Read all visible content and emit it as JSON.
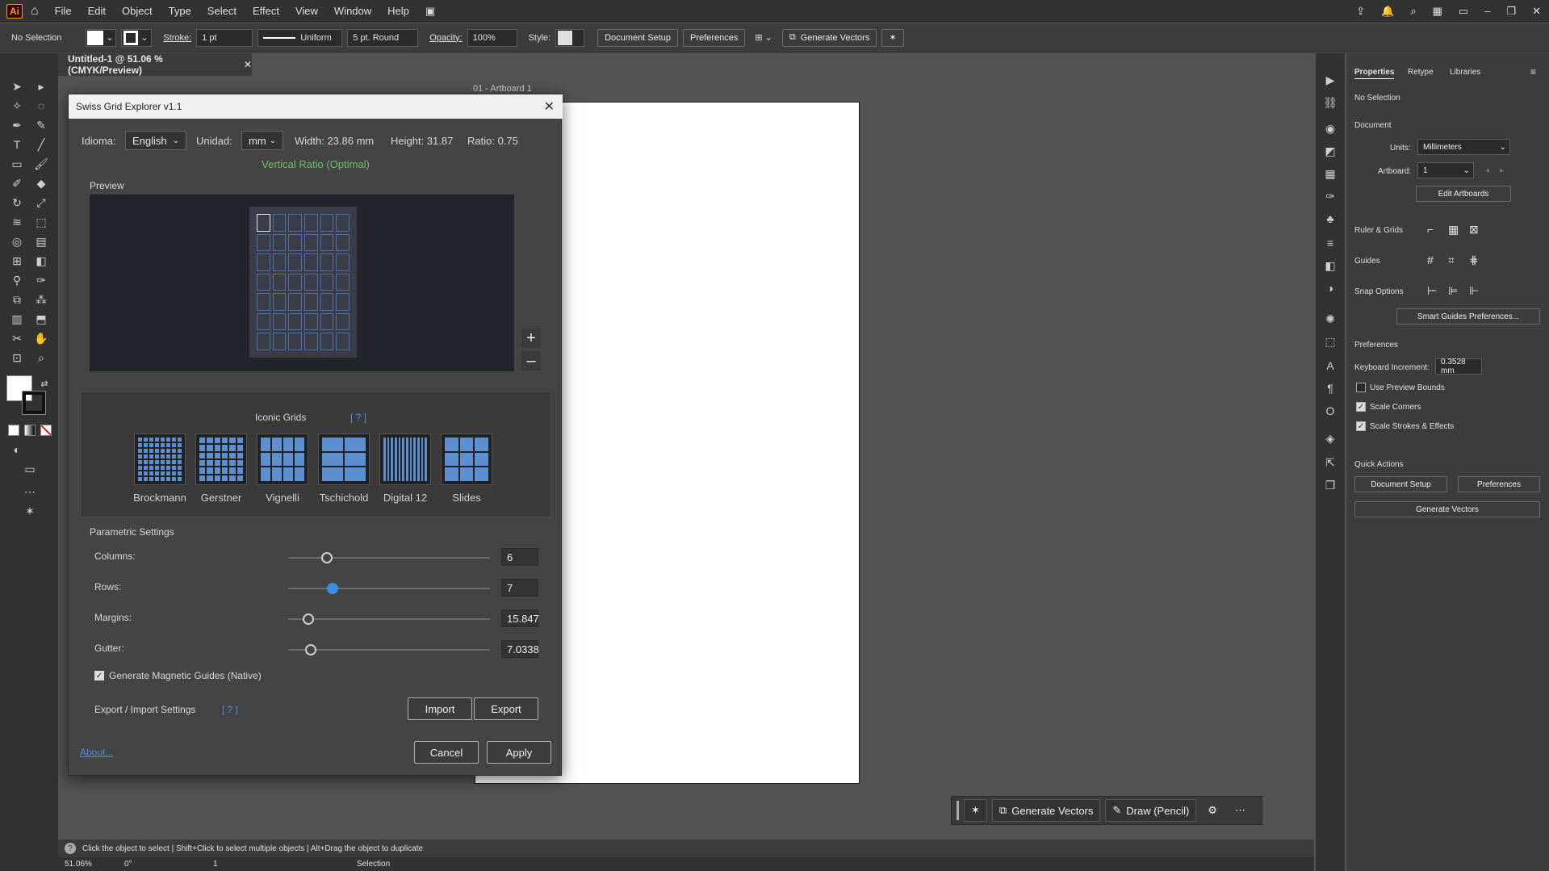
{
  "menubar": {
    "logo": "Ai",
    "items": [
      "File",
      "Edit",
      "Object",
      "Type",
      "Select",
      "Effect",
      "View",
      "Window",
      "Help"
    ]
  },
  "control": {
    "selection": "No Selection",
    "stroke_label": "Stroke:",
    "stroke_value": "1 pt",
    "profile": "Uniform",
    "brush": "5 pt. Round",
    "opacity_label": "Opacity:",
    "opacity_value": "100%",
    "style_label": "Style:",
    "document_setup": "Document Setup",
    "preferences": "Preferences",
    "generate_vectors": "Generate Vectors"
  },
  "document": {
    "tab": "Untitled-1 @ 51.06 % (CMYK/Preview)",
    "artboard_label": "01 - Artboard 1"
  },
  "dialog": {
    "title": "Swiss Grid Explorer v1.1",
    "idioma_label": "Idioma:",
    "idioma_value": "English",
    "unidad_label": "Unidad:",
    "unidad_value": "mm",
    "width": "Width: 23.86 mm",
    "height": "Height: 31.87",
    "ratio": "Ratio: 0.75",
    "ratio_status": "Vertical Ratio (Optimal)",
    "preview_label": "Preview",
    "iconic_label": "Iconic Grids",
    "help_link": "[ ? ]",
    "grids": [
      "Brockmann",
      "Gerstner",
      "Vignelli",
      "Tschichold",
      "Digital 12",
      "Slides"
    ],
    "parametric_label": "Parametric Settings",
    "params": [
      {
        "label": "Columns:",
        "value": "6",
        "pos": 0.19,
        "active": false
      },
      {
        "label": "Rows:",
        "value": "7",
        "pos": 0.22,
        "active": true
      },
      {
        "label": "Margins:",
        "value": "15.847",
        "pos": 0.1,
        "active": false
      },
      {
        "label": "Gutter:",
        "value": "7.0338",
        "pos": 0.11,
        "active": false
      }
    ],
    "magnetic_label": "Generate Magnetic Guides (Native)",
    "export_label": "Export / Import Settings",
    "import": "Import",
    "export": "Export",
    "about": "About...",
    "cancel": "Cancel",
    "apply": "Apply",
    "preview_grid": {
      "columns": 6,
      "rows": 7
    }
  },
  "properties": {
    "tabs": [
      "Properties",
      "Retype",
      "Libraries"
    ],
    "no_selection": "No Selection",
    "document": "Document",
    "units_label": "Units:",
    "units_value": "Millimeters",
    "artboard_label": "Artboard:",
    "artboard_value": "1",
    "edit_artboards": "Edit Artboards",
    "ruler_grids": "Ruler & Grids",
    "guides": "Guides",
    "snap_options": "Snap Options",
    "smart_guides": "Smart Guides Preferences...",
    "preferences": "Preferences",
    "keyboard_increment_label": "Keyboard Increment:",
    "keyboard_increment_value": "0.3528 mm",
    "use_preview_bounds": "Use Preview Bounds",
    "scale_corners": "Scale Corners",
    "scale_strokes": "Scale Strokes & Effects",
    "quick_actions": "Quick Actions",
    "document_setup": "Document Setup",
    "qa_preferences": "Preferences",
    "generate_vectors": "Generate Vectors"
  },
  "context": {
    "generate_vectors": "Generate Vectors",
    "draw": "Draw (Pencil)"
  },
  "status": {
    "hint": "Click the object to select  |  Shift+Click to select multiple objects  |  Alt+Drag the object to duplicate",
    "zoom": "51.06%",
    "rotation": "0°",
    "artboard": "1",
    "tool": "Selection"
  }
}
